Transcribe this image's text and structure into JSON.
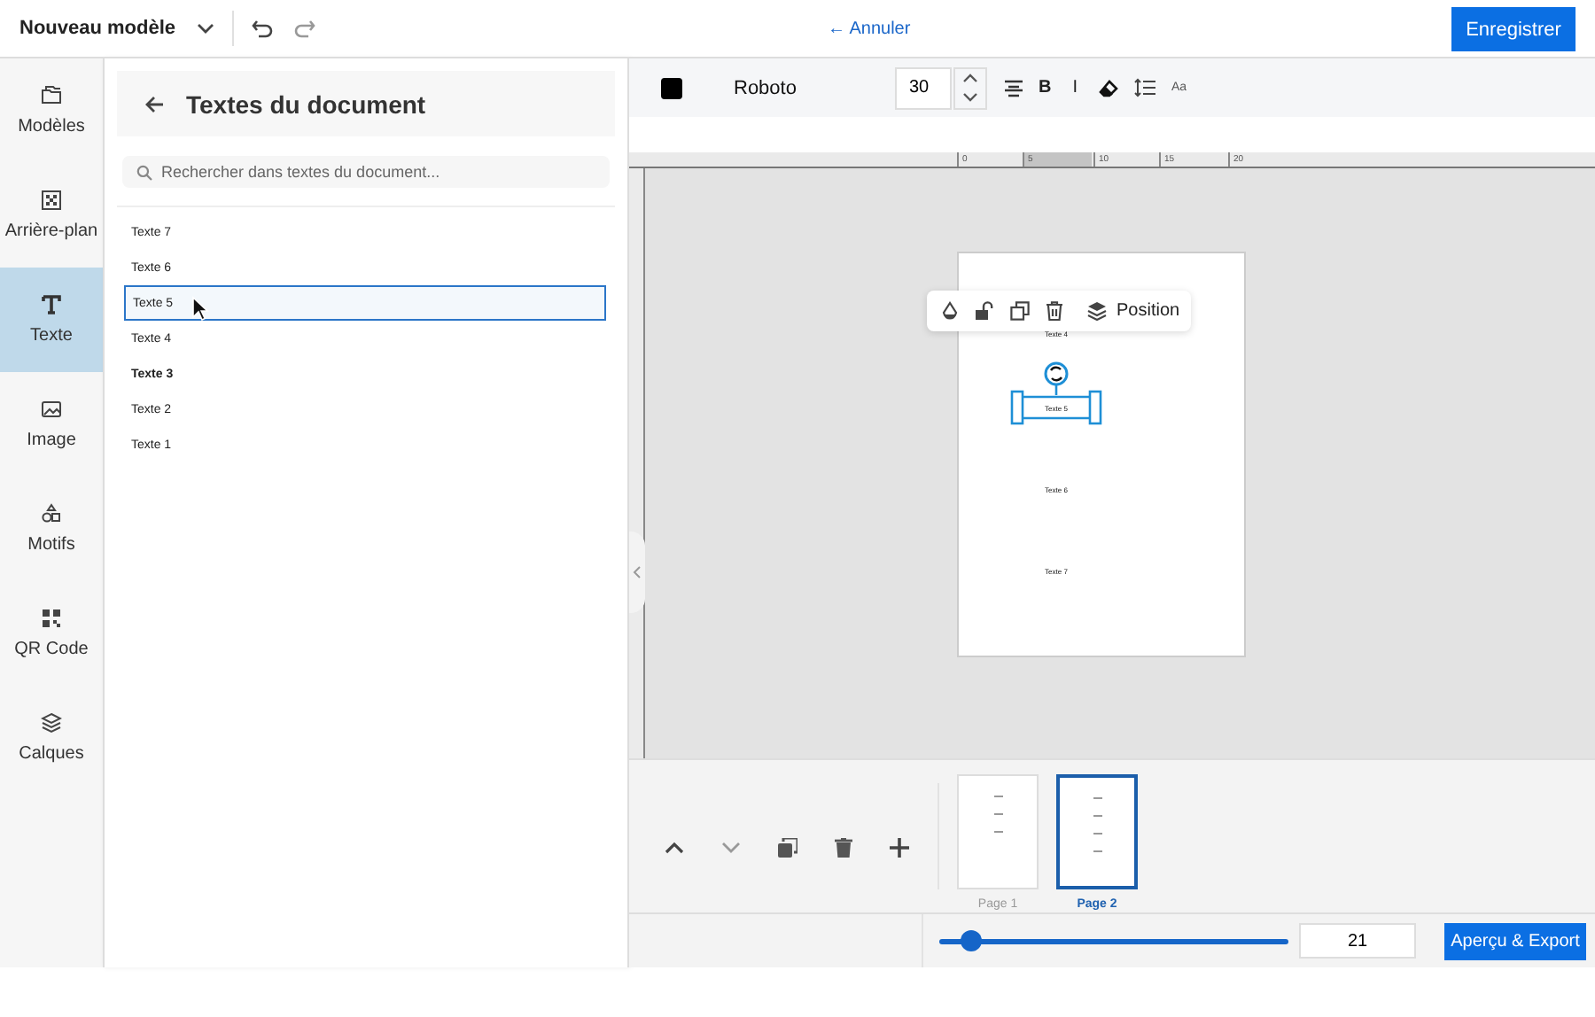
{
  "header": {
    "title": "Nouveau modèle",
    "cancel": "← Annuler",
    "save": "Enregistrer"
  },
  "rail": [
    {
      "label": "Modèles",
      "selected": false
    },
    {
      "label": "Arrière-plan",
      "selected": false
    },
    {
      "label": "Texte",
      "selected": true
    },
    {
      "label": "Image",
      "selected": false
    },
    {
      "label": "Motifs",
      "selected": false
    },
    {
      "label": "QR Code",
      "selected": false
    },
    {
      "label": "Calques",
      "selected": false
    }
  ],
  "panel": {
    "title": "Textes du document",
    "search": {
      "placeholder": "Rechercher dans textes du document..."
    },
    "items": [
      {
        "label": "Texte 7",
        "selected": false,
        "bold": false
      },
      {
        "label": "Texte 6",
        "selected": false,
        "bold": false
      },
      {
        "label": "Texte 5",
        "selected": true,
        "bold": false
      },
      {
        "label": "Texte 4",
        "selected": false,
        "bold": false
      },
      {
        "label": "Texte 3",
        "selected": false,
        "bold": true
      },
      {
        "label": "Texte 2",
        "selected": false,
        "bold": false
      },
      {
        "label": "Texte 1",
        "selected": false,
        "bold": false
      }
    ]
  },
  "toolbar": {
    "font": "Roboto",
    "size": "30",
    "bold_label": "B",
    "italic_label": "I",
    "case_label": "Aa"
  },
  "ruler": [
    "0",
    "5",
    "10",
    "15",
    "20"
  ],
  "canvas": {
    "position_button": "Position",
    "texts": [
      {
        "label": "Texte 4",
        "selected": false
      },
      {
        "label": "Texte 5",
        "selected": true
      },
      {
        "label": "Texte 6",
        "selected": false
      },
      {
        "label": "Texte 7",
        "selected": false
      }
    ]
  },
  "pages": [
    {
      "label": "Page 1",
      "selected": false
    },
    {
      "label": "Page 2",
      "selected": true
    }
  ],
  "footer": {
    "zoom": {
      "level": 0.09
    },
    "zoom_value": "21",
    "export": "Aperçu & Export"
  }
}
